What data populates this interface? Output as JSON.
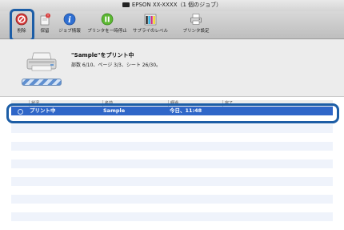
{
  "window": {
    "title": "EPSON XX-XXXX（1 個のジョブ）",
    "title_icon": "printer-icon"
  },
  "toolbar": {
    "buttons": [
      {
        "label": "削除",
        "icon": "delete-icon"
      },
      {
        "label": "保留",
        "icon": "hold-icon"
      },
      {
        "label": "ジョブ情報",
        "icon": "info-icon"
      },
      {
        "label": "プリンタを一時停止",
        "icon": "pause-icon"
      },
      {
        "label": "サプライのレベル",
        "icon": "supply-levels-icon"
      },
      {
        "label": "プリンタ設定",
        "icon": "printer-settings-icon"
      }
    ]
  },
  "status": {
    "job_title": "\"Sample\"をプリント中",
    "job_detail": "部数 6/10、ページ 3/3、シート 26/30。"
  },
  "table": {
    "headers": [
      "状況",
      "名前",
      "経過",
      "完了"
    ],
    "rows": [
      {
        "status": "プリント中",
        "name": "Sample",
        "elapsed": "今日、11:48",
        "completed": ""
      }
    ]
  },
  "colors": {
    "selection": "#2f66c8",
    "highlight": "#1c5da6"
  }
}
